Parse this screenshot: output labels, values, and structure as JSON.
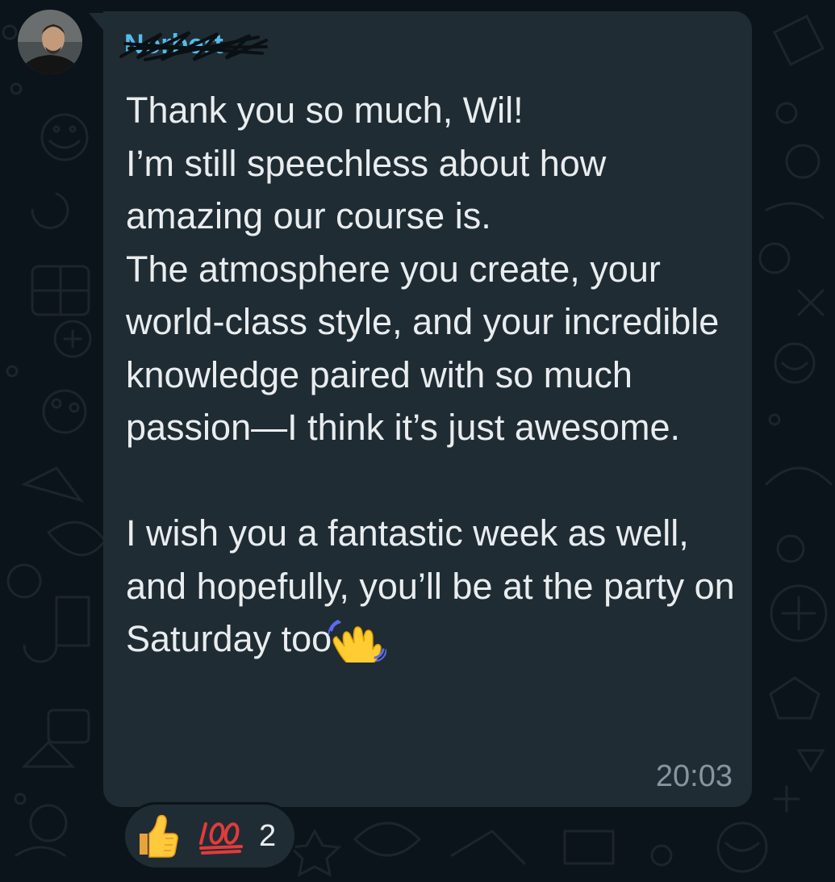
{
  "message": {
    "sender_name": "Norbert",
    "text": "Thank you so much, Wil!\nI’m still speechless about how amazing our course is.\nThe atmosphere you create, your world-class style, and your incredible knowledge paired with so much passion—I think it’s just awesome.\n\nI wish you a fantastic week as well, and hopefully, you’ll be at the party on Saturday too",
    "trailing_emoji": "waving-hand-emoji",
    "time": "20:03"
  },
  "reactions": {
    "emojis": [
      "thumbs-up-emoji",
      "hundred-points-emoji"
    ],
    "count": "2"
  },
  "colors": {
    "background": "#0b141a",
    "bubble": "#202c33",
    "sender": "#53bdeb",
    "text": "#e9edef",
    "meta": "#8696a0"
  }
}
